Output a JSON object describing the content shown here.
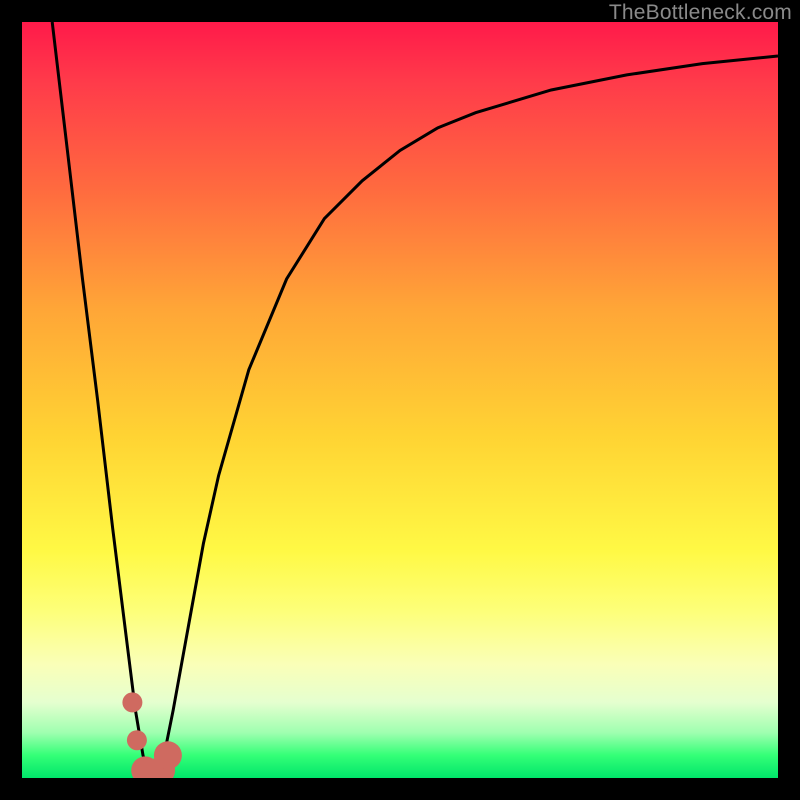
{
  "watermark": "TheBottleneck.com",
  "chart_data": {
    "type": "line",
    "title": "",
    "xlabel": "",
    "ylabel": "",
    "xlim": [
      0,
      100
    ],
    "ylim": [
      0,
      100
    ],
    "grid": false,
    "legend": false,
    "background_gradient": {
      "top_color": "#ff1a4a",
      "bottom_color": "#00e56a",
      "note": "red (top) → yellow (mid) → green (bottom) representing bottleneck severity"
    },
    "series": [
      {
        "name": "bottleneck-curve",
        "color": "#000000",
        "x": [
          4,
          6,
          8,
          10,
          12,
          14,
          15,
          16,
          17,
          18,
          19,
          20,
          22,
          24,
          26,
          30,
          35,
          40,
          45,
          50,
          55,
          60,
          70,
          80,
          90,
          100
        ],
        "y": [
          100,
          83,
          66,
          50,
          33,
          17,
          9,
          3,
          0,
          1,
          4,
          9,
          20,
          31,
          40,
          54,
          66,
          74,
          79,
          83,
          86,
          88,
          91,
          93,
          94.5,
          95.5
        ]
      },
      {
        "name": "highlight-points",
        "color": "#cf6a60",
        "type": "scatter",
        "x": [
          14.6,
          15.2,
          16.3,
          17.4,
          18.4,
          19.3
        ],
        "y": [
          10,
          5,
          1,
          0.5,
          1,
          3
        ],
        "marker_size": [
          10,
          10,
          14,
          14,
          14,
          14
        ]
      }
    ],
    "optimum_x": 17
  }
}
